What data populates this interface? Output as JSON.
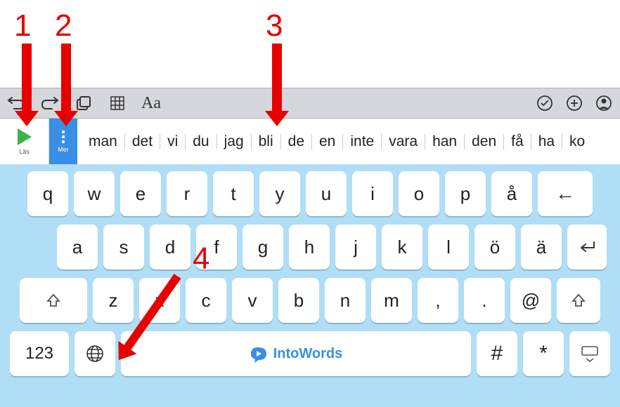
{
  "toolbar": {
    "icons": [
      "undo-icon",
      "redo-icon",
      "layers-icon",
      "table-icon",
      "font-icon",
      "check-circle-icon",
      "plus-circle-icon",
      "person-circle-icon"
    ]
  },
  "las": {
    "label": "Läs"
  },
  "mer": {
    "label": "Mer"
  },
  "predictions": [
    "man",
    "det",
    "vi",
    "du",
    "jag",
    "bli",
    "de",
    "en",
    "inte",
    "vara",
    "han",
    "den",
    "få",
    "ha",
    "ko"
  ],
  "keyboard": {
    "row1": [
      "q",
      "w",
      "e",
      "r",
      "t",
      "y",
      "u",
      "i",
      "o",
      "p",
      "å"
    ],
    "row2": [
      "a",
      "s",
      "d",
      "f",
      "g",
      "h",
      "j",
      "k",
      "l",
      "ö",
      "ä"
    ],
    "row3": [
      "z",
      "x",
      "c",
      "v",
      "b",
      "n",
      "m",
      ",",
      ".",
      "@"
    ],
    "num_label": "123",
    "hash": "#",
    "star": "*",
    "space_brand": "IntoWords"
  },
  "annotations": {
    "n1": "1",
    "n2": "2",
    "n3": "3",
    "n4": "4"
  }
}
